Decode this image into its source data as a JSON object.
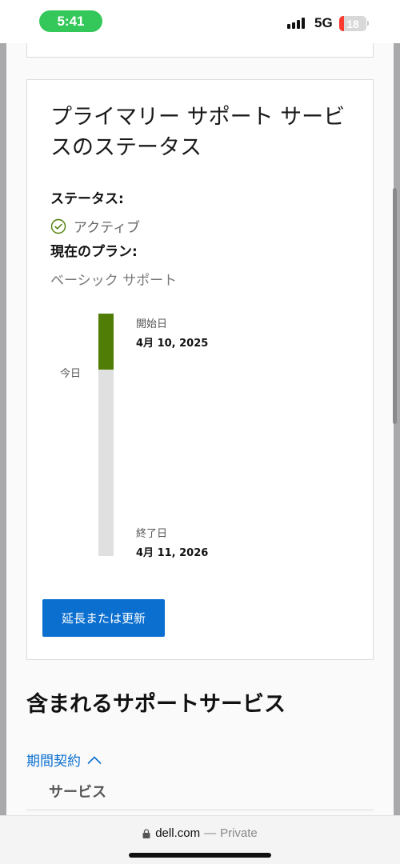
{
  "status_bar": {
    "time": "5:41",
    "network": "5G",
    "battery": "18",
    "battery_fill": 0.18
  },
  "card": {
    "title": "プライマリー サポート サービスのステータス",
    "status_label": "ステータス:",
    "status_value": "アクティブ",
    "plan_label": "現在のプラン:",
    "plan_value": "ベーシック サポート",
    "timeline": {
      "start_label": "開始日",
      "start_date": "4月 10, 2025",
      "today_label": "今日",
      "end_label": "終了日",
      "end_date": "4月 11, 2026",
      "progress_fraction": 0.23
    },
    "renew_button": "延長または更新"
  },
  "included_section": {
    "title": "含まれるサポートサービス",
    "accordion_label": "期間契約",
    "service_label": "サービス"
  },
  "browser": {
    "domain": "dell.com",
    "separator": "—",
    "mode": "Private"
  },
  "colors": {
    "accent_blue": "#0b6fcf",
    "progress_green": "#4f7d06",
    "time_pill_green": "#34c759"
  }
}
